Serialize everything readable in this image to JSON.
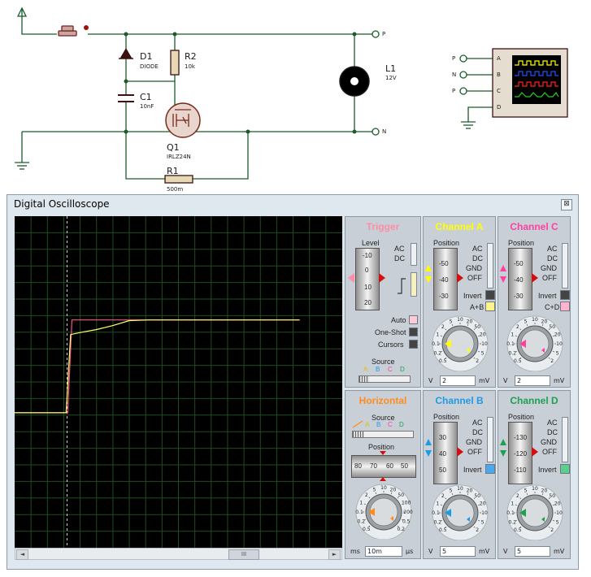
{
  "schematic": {
    "d1": {
      "ref": "D1",
      "value": "DIODE"
    },
    "r2": {
      "ref": "R2",
      "value": "10k"
    },
    "c1": {
      "ref": "C1",
      "value": "10nF"
    },
    "q1": {
      "ref": "Q1",
      "value": "IRLZ24N"
    },
    "r1": {
      "ref": "R1",
      "value": "500m"
    },
    "l1": {
      "ref": "L1",
      "value": "12V"
    },
    "terminal_p": "P",
    "terminal_n": "N",
    "scope_inputs": [
      {
        "terminal": "P",
        "channel": "A"
      },
      {
        "terminal": "N",
        "channel": "B"
      },
      {
        "terminal": "P",
        "channel": "C"
      },
      {
        "terminal": "",
        "channel": "D"
      }
    ]
  },
  "oscilloscope": {
    "title": "Digital Oscilloscope",
    "close_glyph": "⊠",
    "trigger": {
      "title": "Trigger",
      "level_label": "Level",
      "level_scale": [
        "-10",
        "0",
        "10",
        "20"
      ],
      "ac": "AC",
      "dc": "DC",
      "auto": "Auto",
      "oneshot": "One-Shot",
      "cursors": "Cursors",
      "source_label": "Source",
      "source_letters": [
        "A",
        "B",
        "C",
        "D"
      ]
    },
    "horizontal": {
      "title": "Horizontal",
      "source_label": "Source",
      "source_letters": [
        "A",
        "B",
        "C",
        "D"
      ],
      "position_label": "Position",
      "position_scale": [
        "80",
        "70",
        "60",
        "50"
      ],
      "dial_marks": [
        "0.5",
        "0.2",
        "0.1",
        "1",
        "2",
        "5",
        "10",
        "20",
        "50",
        "100",
        "200",
        "0.5",
        "0.2"
      ],
      "unit_left": "ms",
      "value": "10m",
      "unit_right": "µs"
    },
    "channels": [
      {
        "id": "a",
        "title": "Channel A",
        "color": "#ffff00",
        "position_label": "Position",
        "scale": [
          "-50",
          "-40",
          "-30"
        ],
        "ac": "AC",
        "dc": "DC",
        "gnd": "GND",
        "off": "OFF",
        "invert": "Invert",
        "combo": "A+B",
        "dial_marks": [
          "0.5",
          "0.2",
          "0.1",
          "1",
          "2",
          "5",
          "10",
          "20",
          "50",
          "20",
          "10",
          "5",
          "2"
        ],
        "unit_left": "V",
        "value": "2",
        "unit_right": "mV"
      },
      {
        "id": "c",
        "title": "Channel C",
        "color": "#ff40a0",
        "position_label": "Position",
        "scale": [
          "-50",
          "-40",
          "-30"
        ],
        "ac": "AC",
        "dc": "DC",
        "gnd": "GND",
        "off": "OFF",
        "invert": "Invert",
        "combo": "C+D",
        "dial_marks": [
          "0.5",
          "0.2",
          "0.1",
          "1",
          "2",
          "5",
          "10",
          "20",
          "50",
          "20",
          "10",
          "5",
          "2"
        ],
        "unit_left": "V",
        "value": "2",
        "unit_right": "mV"
      },
      {
        "id": "b",
        "title": "Channel B",
        "color": "#1e9be6",
        "position_label": "Position",
        "scale": [
          "30",
          "40",
          "50"
        ],
        "ac": "AC",
        "dc": "DC",
        "gnd": "GND",
        "off": "OFF",
        "invert": "Invert",
        "combo": "",
        "dial_marks": [
          "0.5",
          "0.2",
          "0.1",
          "1",
          "2",
          "5",
          "10",
          "20",
          "50",
          "20",
          "10",
          "5",
          "2"
        ],
        "unit_left": "V",
        "value": "5",
        "unit_right": "mV"
      },
      {
        "id": "d",
        "title": "Channel D",
        "color": "#1ea050",
        "position_label": "Position",
        "scale": [
          "-130",
          "-120",
          "-110"
        ],
        "ac": "AC",
        "dc": "DC",
        "gnd": "GND",
        "off": "OFF",
        "invert": "Invert",
        "combo": "",
        "dial_marks": [
          "0.5",
          "0.2",
          "0.1",
          "1",
          "2",
          "5",
          "10",
          "20",
          "50",
          "20",
          "10",
          "5",
          "2"
        ],
        "unit_left": "V",
        "value": "5",
        "unit_right": "mV"
      }
    ],
    "colors": {
      "trigger_title": "#ff8da8",
      "horizontal_title": "#ff8c1a",
      "screen_bg": "#000000",
      "grid": "#1f4d1f",
      "trace_a": "#ffff66",
      "trace_c": "#ff5090"
    },
    "traces": {
      "trace_a": [
        [
          0,
          0.593
        ],
        [
          0.157,
          0.593
        ],
        [
          0.166,
          0.438
        ],
        [
          0.171,
          0.357
        ],
        [
          0.2,
          0.351
        ],
        [
          0.25,
          0.342
        ],
        [
          0.3,
          0.33
        ],
        [
          0.35,
          0.315
        ],
        [
          0.41,
          0.313
        ],
        [
          0.5,
          0.313
        ],
        [
          0.7,
          0.313
        ],
        [
          0.87,
          0.313
        ]
      ],
      "trace_c": [
        [
          0,
          0.593
        ],
        [
          0.162,
          0.593
        ],
        [
          0.175,
          0.313
        ],
        [
          0.87,
          0.313
        ]
      ]
    },
    "scroll": {
      "left": "◄",
      "right": "►",
      "thumb": "III"
    }
  }
}
